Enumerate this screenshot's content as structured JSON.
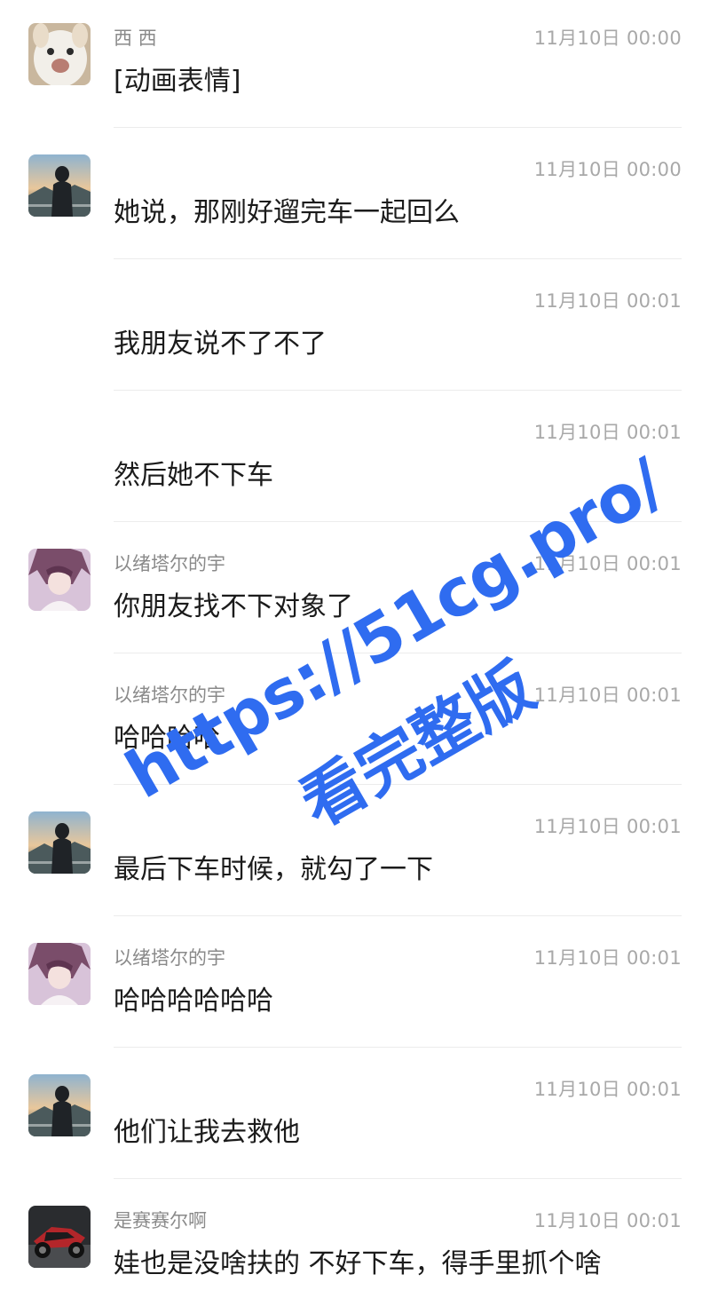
{
  "messages": [
    {
      "avatar": "cat-avatar",
      "sender": "西 西",
      "time": "11月10日 00:00",
      "text": "[动画表情]"
    },
    {
      "avatar": "landscape-avatar",
      "sender": "",
      "time": "11月10日 00:00",
      "text": "她说，那刚好遛完车一起回么"
    },
    {
      "avatar": "",
      "sender": "",
      "time": "11月10日 00:01",
      "text": "我朋友说不了不了"
    },
    {
      "avatar": "",
      "sender": "",
      "time": "11月10日 00:01",
      "text": "然后她不下车"
    },
    {
      "avatar": "anime-avatar",
      "sender": "以绪塔尔的宇",
      "time": "11月10日 00:01",
      "text": "你朋友找不下对象了"
    },
    {
      "avatar": "",
      "sender": "以绪塔尔的宇",
      "time": "11月10日 00:01",
      "text": "哈哈哈哈"
    },
    {
      "avatar": "landscape-avatar",
      "sender": "",
      "time": "11月10日 00:01",
      "text": "最后下车时候，就勾了一下"
    },
    {
      "avatar": "anime-avatar",
      "sender": "以绪塔尔的宇",
      "time": "11月10日 00:01",
      "text": "哈哈哈哈哈哈"
    },
    {
      "avatar": "landscape-avatar",
      "sender": "",
      "time": "11月10日 00:01",
      "text": "他们让我去救他"
    },
    {
      "avatar": "motorcycle-avatar",
      "sender": "是赛赛尔啊",
      "time": "11月10日 00:01",
      "text": "娃也是没啥扶的 不好下车，得手里抓个啥"
    }
  ],
  "watermark": {
    "line1": "https://51cg.pro/",
    "line2": "看完整版",
    "color": "#2f6cf0"
  }
}
